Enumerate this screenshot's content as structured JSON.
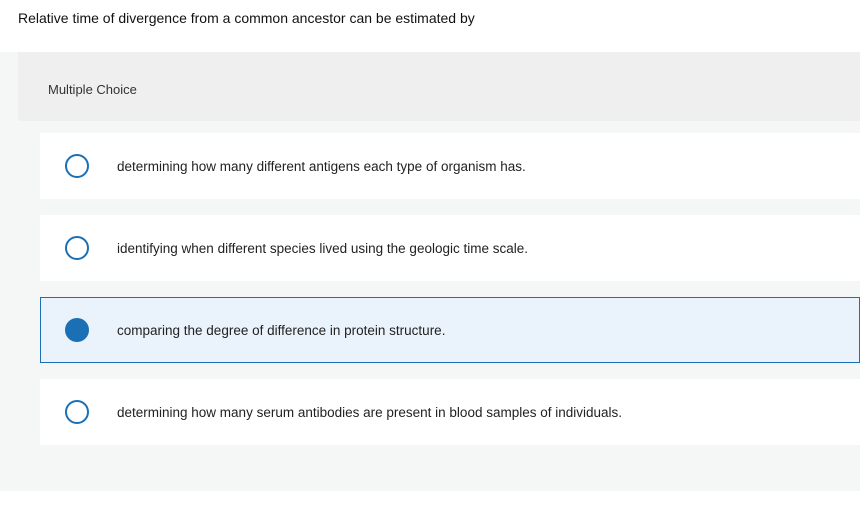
{
  "question": {
    "stem": "Relative time of divergence from a common ancestor can be estimated by",
    "type_label": "Multiple Choice"
  },
  "options": [
    {
      "text": "determining how many different antigens each type of organism has.",
      "selected": false
    },
    {
      "text": "identifying when different species lived using the geologic time scale.",
      "selected": false
    },
    {
      "text": "comparing the degree of difference in protein structure.",
      "selected": true
    },
    {
      "text": "determining how many serum antibodies are present in blood samples of individuals.",
      "selected": false
    }
  ],
  "colors": {
    "option_bg": "#ffffff",
    "option_selected_bg": "#eaf3fb",
    "accent": "#1a6fb5",
    "panel_bg": "#f5f6f6",
    "header_bg": "#efefef"
  }
}
